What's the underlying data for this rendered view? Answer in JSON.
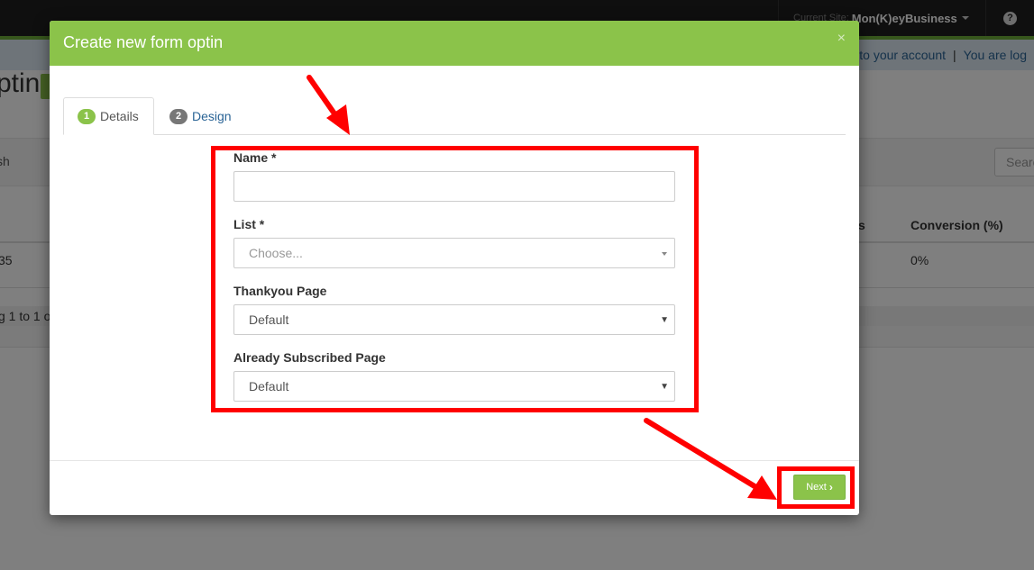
{
  "background": {
    "current_site_label": "Current Site:",
    "current_site_name": "Mon(K)eyBusiness",
    "help_glyph": "?",
    "account_link": "to your account",
    "account_separator": "|",
    "logged_in_text": "You are log",
    "page_title_fragment": "ptin",
    "search_fragment": "sh",
    "search_placeholder_fragment": "Searc",
    "table": {
      "col_s_fragment": "s",
      "col_conversion": "Conversion (%)",
      "row_id_fragment": "35",
      "row_conversion": "0%"
    },
    "showing_fragment": "g 1 to 1 o"
  },
  "modal": {
    "title": "Create new form optin",
    "close_glyph": "×",
    "tabs": [
      {
        "number": "1",
        "label": "Details",
        "active": true
      },
      {
        "number": "2",
        "label": "Design",
        "active": false
      }
    ],
    "fields": {
      "name_label": "Name *",
      "name_value": "",
      "list_label": "List *",
      "list_placeholder": "Choose...",
      "thankyou_label": "Thankyou Page",
      "thankyou_value": "Default",
      "subscribed_label": "Already Subscribed Page",
      "subscribed_value": "Default"
    },
    "next_label": "Next",
    "next_icon": "chevron-right-icon"
  },
  "colors": {
    "modal_header": "#8bc34a",
    "annotation": "#ff0000",
    "topbar": "#1f1f1f"
  }
}
